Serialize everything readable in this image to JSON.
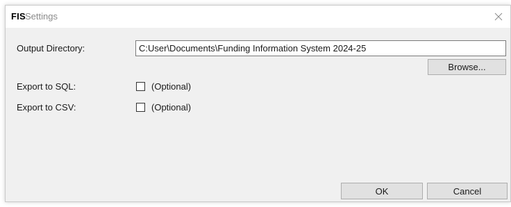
{
  "window": {
    "title_app": "FIS",
    "title_text": "Settings"
  },
  "output_directory": {
    "label": "Output Directory:",
    "value": "C:User\\Documents\\Funding Information System 2024-25",
    "browse_label": "Browse..."
  },
  "export_sql": {
    "label": "Export to SQL:",
    "option_label": "(Optional)",
    "checked": false
  },
  "export_csv": {
    "label": "Export to CSV:",
    "option_label": "(Optional)",
    "checked": false
  },
  "footer": {
    "ok_label": "OK",
    "cancel_label": "Cancel"
  },
  "icons": {
    "close": "close-icon"
  }
}
